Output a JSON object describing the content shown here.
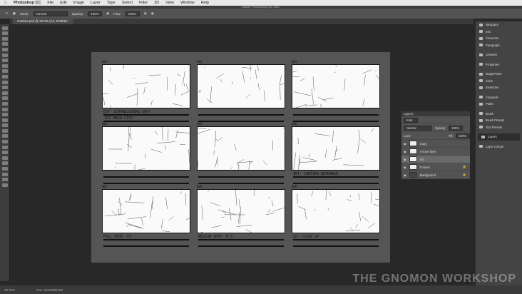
{
  "menu": {
    "apple": "",
    "app": "Photoshop CC",
    "items": [
      "File",
      "Edit",
      "Image",
      "Layer",
      "Type",
      "Select",
      "Filter",
      "3D",
      "View",
      "Window",
      "Help"
    ]
  },
  "window_title": "Adobe Photoshop CC 2017",
  "options": {
    "mode_label": "Mode:",
    "mode": "Normal",
    "opacity_label": "Opacity:",
    "opacity": "100%",
    "flow_label": "Flow:",
    "flow": "100%"
  },
  "doc_tab": "Cantina.psd @ 33.3% (Art, RGB/8) *",
  "storyboard": {
    "panels": [
      {
        "num": "001",
        "caption1": "EST- ESTABLISHING SHOT",
        "caption2": "EXT MEGA CITY"
      },
      {
        "num": "002",
        "caption1": "",
        "caption2": ""
      },
      {
        "num": "003",
        "caption1": "",
        "caption2": ""
      },
      {
        "num": "004",
        "caption1": "",
        "caption2": ""
      },
      {
        "num": "005",
        "caption1": "",
        "caption2": ""
      },
      {
        "num": "006",
        "caption1": "INT- CANTINA ENTRANCE",
        "caption2": ""
      },
      {
        "num": "007",
        "caption1": "FULL SHOT- FS",
        "caption2": ""
      },
      {
        "num": "008",
        "caption1": "MEDIUM SHOT- M.S",
        "caption2": ""
      },
      {
        "num": "009",
        "caption1": "CU- CLOSE UP",
        "caption2": ""
      }
    ]
  },
  "layers": {
    "title": "Layers",
    "kind": "Kind",
    "blend": "Normal",
    "opacity_label": "Opacity:",
    "opacity": "100%",
    "lock_label": "Lock:",
    "fill_label": "Fill:",
    "fill": "100%",
    "items": [
      "Copy",
      "Arrows layer",
      "Art",
      "Frames",
      "Background"
    ]
  },
  "dock": [
    "Navigator",
    "Info",
    "Character",
    "Paragraph",
    "Libraries",
    "Properties",
    "MagicPicker",
    "Color",
    "Swatches",
    "Channels",
    "Paths",
    "Brush",
    "Brush Presets",
    "Tool Presets",
    "Layers",
    "Layer Comps"
  ],
  "status": {
    "zoom": "33.33%",
    "doc": "Doc: 24.9M/85.0M"
  },
  "watermark": "THE GNOMON WORKSHOP"
}
